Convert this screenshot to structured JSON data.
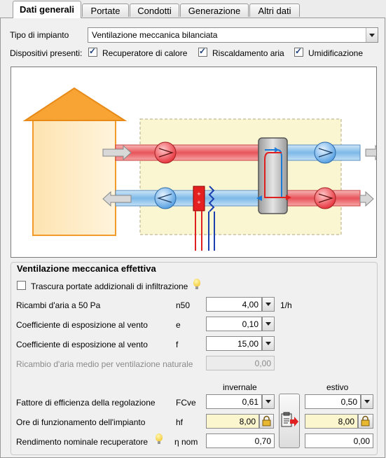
{
  "tabs": [
    {
      "label": "Dati generali",
      "active": true
    },
    {
      "label": "Portate"
    },
    {
      "label": "Condotti"
    },
    {
      "label": "Generazione"
    },
    {
      "label": "Altri dati"
    }
  ],
  "tipo": {
    "label": "Tipo di impianto",
    "value": "Ventilazione meccanica bilanciata"
  },
  "dispositivi": {
    "label": "Dispositivi presenti:",
    "items": [
      {
        "label": "Recuperatore di calore",
        "checked": true
      },
      {
        "label": "Riscaldamento aria",
        "checked": true
      },
      {
        "label": "Umidificazione",
        "checked": true
      }
    ]
  },
  "section": {
    "title": "Ventilazione meccanica effettiva",
    "trascura": {
      "label": "Trascura portate addizionali di infiltrazione",
      "checked": false
    },
    "rows": [
      {
        "label": "Ricambi d'aria a 50 Pa",
        "symbol": "n50",
        "value": "4,00",
        "unit": "1/h"
      },
      {
        "label": "Coefficiente di esposizione al vento",
        "symbol": "e",
        "value": "0,10"
      },
      {
        "label": "Coefficiente di esposizione al vento",
        "symbol": "f",
        "value": "15,00"
      }
    ],
    "naturale": {
      "label": "Ricambio d'aria medio per ventilazione naturale",
      "value": "0,00"
    },
    "col_invernale": "invernale",
    "col_estivo": "estivo",
    "fattore": {
      "label": "Fattore di efficienza della regolazione",
      "symbol": "FCve",
      "inv": "0,61",
      "est": "0,50"
    },
    "ore": {
      "label": "Ore di funzionamento dell'impianto",
      "symbol": "hf",
      "inv": "8,00",
      "est": "8,00"
    },
    "rendimento": {
      "label": "Rendimento nominale recuperatore",
      "symbol": "η nom",
      "inv": "0,70",
      "est": "0,00"
    }
  },
  "colors": {
    "accent_red": "#e02020",
    "accent_blue": "#1a3fb0",
    "house": "#f5a030"
  }
}
